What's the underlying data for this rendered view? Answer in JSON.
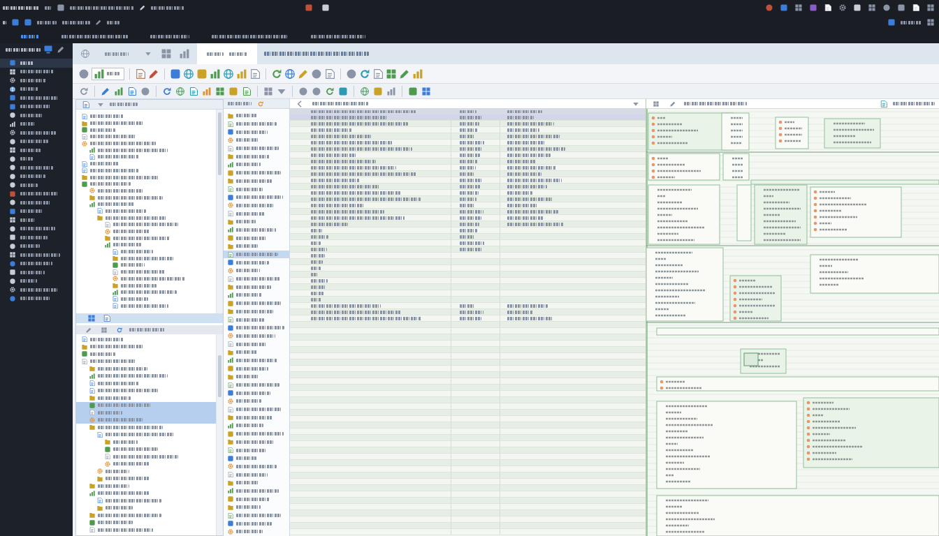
{
  "top_bar": {
    "tabs": [
      {
        "selected": true
      },
      {
        "selected": false
      },
      {
        "selected": false
      },
      {
        "selected": false
      },
      {
        "selected": false
      }
    ]
  },
  "sidebar": {
    "items": [
      {
        "selected": true
      },
      {
        "selected": false
      },
      {
        "selected": false
      },
      {
        "selected": false
      },
      {
        "selected": false
      },
      {
        "selected": false
      },
      {
        "selected": false
      },
      {
        "selected": false
      },
      {
        "selected": false
      },
      {
        "selected": false
      },
      {
        "selected": false
      },
      {
        "selected": false
      },
      {
        "selected": false
      },
      {
        "selected": false
      },
      {
        "selected": false
      },
      {
        "selected": false
      },
      {
        "selected": false
      },
      {
        "selected": false
      },
      {
        "selected": false
      },
      {
        "selected": false
      },
      {
        "selected": false
      },
      {
        "selected": false
      },
      {
        "selected": false
      },
      {
        "selected": false
      },
      {
        "selected": false
      },
      {
        "selected": false
      },
      {
        "selected": false
      },
      {
        "selected": false
      }
    ]
  },
  "ribbon": {
    "tabs": [
      {
        "selected": false
      },
      {
        "selected": true
      }
    ]
  },
  "explorer": {
    "upper_tree": [
      {
        "selected": false
      },
      {
        "selected": false
      },
      {
        "selected": false
      },
      {
        "selected": false
      },
      {
        "selected": false,
        "children": [
          {
            "selected": false
          },
          {
            "selected": false
          }
        ]
      },
      {
        "selected": false
      },
      {
        "selected": false
      },
      {
        "selected": false
      },
      {
        "selected": false,
        "children": [
          {
            "selected": false
          },
          {
            "selected": false
          },
          {
            "selected": false,
            "children": [
              {
                "selected": false
              },
              {
                "selected": false,
                "children": [
                  {
                    "selected": false
                  },
                  {
                    "selected": false
                  },
                  {
                    "selected": false
                  },
                  {
                    "selected": false,
                    "children": [
                      {
                        "selected": false
                      },
                      {
                        "selected": false
                      },
                      {
                        "selected": false
                      },
                      {
                        "selected": false
                      },
                      {
                        "selected": false
                      },
                      {
                        "selected": false
                      },
                      {
                        "selected": false
                      },
                      {
                        "selected": false
                      },
                      {
                        "selected": false
                      }
                    ]
                  }
                ]
              }
            ]
          }
        ]
      }
    ],
    "lower_tree": [
      {
        "selected": false
      },
      {
        "selected": false
      },
      {
        "selected": false
      },
      {
        "selected": false,
        "children": [
          {
            "selected": false
          },
          {
            "selected": false
          },
          {
            "selected": false
          },
          {
            "selected": false
          },
          {
            "selected": false
          },
          {
            "selected": true
          },
          {
            "selected": true
          },
          {
            "selected": true
          },
          {
            "selected": false,
            "children": [
              {
                "selected": false,
                "children": [
                  {
                    "selected": false
                  },
                  {
                    "selected": false
                  },
                  {
                    "selected": false
                  },
                  {
                    "selected": false
                  }
                ]
              },
              {
                "selected": false
              },
              {
                "selected": false
              }
            ]
          },
          {
            "selected": false
          },
          {
            "selected": false,
            "children": [
              {
                "selected": false
              },
              {
                "selected": false
              }
            ]
          },
          {
            "selected": false
          },
          {
            "selected": false
          },
          {
            "selected": false
          }
        ]
      }
    ]
  },
  "outline": {
    "rows": [
      {
        "selected": false
      },
      {
        "selected": false
      },
      {
        "selected": false
      },
      {
        "selected": false
      },
      {
        "selected": false
      },
      {
        "selected": false
      },
      {
        "selected": false
      },
      {
        "selected": false
      },
      {
        "selected": false
      },
      {
        "selected": false
      },
      {
        "selected": false
      },
      {
        "selected": false
      },
      {
        "selected": false
      },
      {
        "selected": false
      },
      {
        "selected": false
      },
      {
        "selected": false
      },
      {
        "selected": false
      },
      {
        "selected": true
      },
      {
        "selected": false
      },
      {
        "selected": false
      },
      {
        "selected": false
      },
      {
        "selected": false
      },
      {
        "selected": false
      },
      {
        "selected": false
      },
      {
        "selected": false
      },
      {
        "selected": false
      },
      {
        "selected": false
      },
      {
        "selected": false
      },
      {
        "selected": false
      },
      {
        "selected": false
      },
      {
        "selected": false
      },
      {
        "selected": false
      },
      {
        "selected": false
      },
      {
        "selected": false
      },
      {
        "selected": false
      },
      {
        "selected": false
      },
      {
        "selected": false
      },
      {
        "selected": false
      },
      {
        "selected": false
      },
      {
        "selected": false
      },
      {
        "selected": false
      },
      {
        "selected": false
      },
      {
        "selected": false
      },
      {
        "selected": false
      },
      {
        "selected": false
      },
      {
        "selected": false
      },
      {
        "selected": false
      },
      {
        "selected": false
      },
      {
        "selected": false
      },
      {
        "selected": false
      },
      {
        "selected": false
      },
      {
        "selected": false
      }
    ]
  },
  "table": {
    "rows": [
      {
        "kind": "full",
        "selected": true
      },
      {
        "kind": "full",
        "selected": false
      },
      {
        "kind": "full",
        "selected": false
      },
      {
        "kind": "full",
        "selected": false
      },
      {
        "kind": "full",
        "selected": false
      },
      {
        "kind": "full",
        "selected": false
      },
      {
        "kind": "full",
        "selected": false
      },
      {
        "kind": "full",
        "selected": false
      },
      {
        "kind": "full",
        "selected": false
      },
      {
        "kind": "full",
        "selected": false
      },
      {
        "kind": "full",
        "selected": false
      },
      {
        "kind": "full",
        "selected": false
      },
      {
        "kind": "full",
        "selected": false
      },
      {
        "kind": "full",
        "selected": false
      },
      {
        "kind": "full",
        "selected": false
      },
      {
        "kind": "full",
        "selected": false
      },
      {
        "kind": "full",
        "selected": false
      },
      {
        "kind": "full",
        "selected": false
      },
      {
        "kind": "two",
        "selected": false
      },
      {
        "kind": "two",
        "selected": false
      },
      {
        "kind": "two",
        "selected": false
      },
      {
        "kind": "two",
        "selected": false
      },
      {
        "kind": "one",
        "selected": false
      },
      {
        "kind": "one",
        "selected": false
      },
      {
        "kind": "one",
        "selected": false
      },
      {
        "kind": "one",
        "selected": false
      },
      {
        "kind": "one",
        "selected": false
      },
      {
        "kind": "one",
        "selected": false
      },
      {
        "kind": "one",
        "selected": false
      },
      {
        "kind": "one",
        "selected": false
      },
      {
        "kind": "full",
        "selected": false
      },
      {
        "kind": "full",
        "selected": false
      },
      {
        "kind": "full",
        "selected": false
      },
      {
        "kind": "blank",
        "selected": false
      },
      {
        "kind": "blank",
        "selected": false
      },
      {
        "kind": "blank",
        "selected": false
      },
      {
        "kind": "blank",
        "selected": false
      },
      {
        "kind": "blank",
        "selected": false
      },
      {
        "kind": "blank",
        "selected": false
      },
      {
        "kind": "blank",
        "selected": false
      },
      {
        "kind": "blank",
        "selected": false
      },
      {
        "kind": "blank",
        "selected": false
      },
      {
        "kind": "blank",
        "selected": false
      },
      {
        "kind": "blank",
        "selected": false
      },
      {
        "kind": "blank",
        "selected": false
      },
      {
        "kind": "blank",
        "selected": false
      },
      {
        "kind": "blank",
        "selected": false
      },
      {
        "kind": "blank",
        "selected": false
      },
      {
        "kind": "blank",
        "selected": false
      },
      {
        "kind": "blank",
        "selected": false
      },
      {
        "kind": "blank",
        "selected": false
      },
      {
        "kind": "blank",
        "selected": false
      },
      {
        "kind": "blank",
        "selected": false
      },
      {
        "kind": "blank",
        "selected": false
      },
      {
        "kind": "blank",
        "selected": false
      },
      {
        "kind": "blank",
        "selected": false
      },
      {
        "kind": "blank",
        "selected": false
      },
      {
        "kind": "blank",
        "selected": false
      },
      {
        "kind": "blank",
        "selected": false
      },
      {
        "kind": "blank",
        "selected": false
      },
      {
        "kind": "blank",
        "selected": false
      },
      {
        "kind": "blank",
        "selected": false
      },
      {
        "kind": "blank",
        "selected": false
      },
      {
        "kind": "blank",
        "selected": false
      },
      {
        "kind": "blank",
        "selected": false
      },
      {
        "kind": "blank",
        "selected": false
      },
      {
        "kind": "blank",
        "selected": false
      }
    ]
  }
}
